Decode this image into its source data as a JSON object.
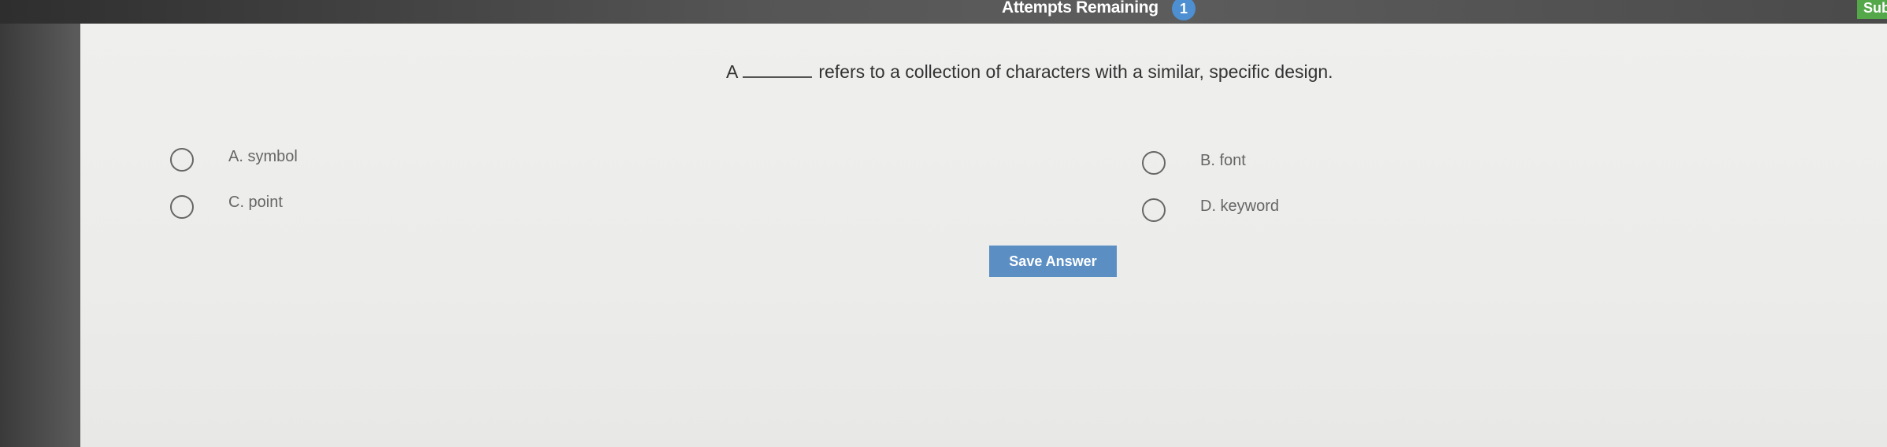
{
  "header": {
    "attempts_label": "Attempts Remaining",
    "attempts_count": "1",
    "submit_label": "Submit"
  },
  "question": {
    "prefix": "A",
    "suffix": "refers to a collection of characters with a similar, specific design."
  },
  "options": [
    {
      "label": "A. symbol"
    },
    {
      "label": "B. font"
    },
    {
      "label": "C. point"
    },
    {
      "label": "D. keyword"
    }
  ],
  "actions": {
    "save_label": "Save Answer"
  },
  "colors": {
    "accent": "#5b8fc4",
    "badge": "#4d8fd1",
    "submit": "#55a84a"
  }
}
